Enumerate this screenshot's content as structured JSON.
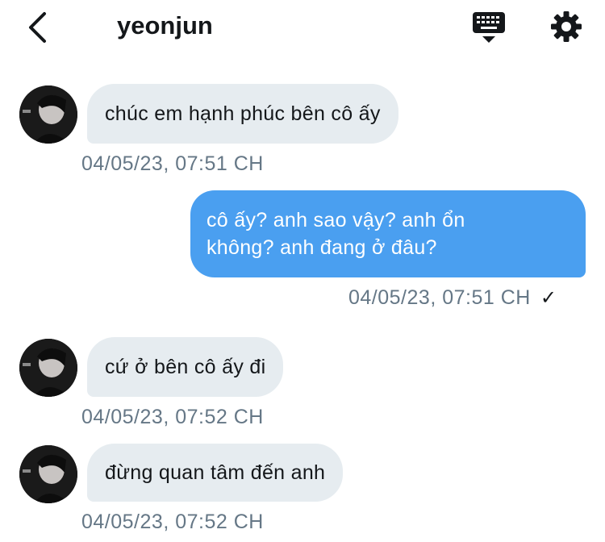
{
  "header": {
    "title": "yeonjun",
    "back_icon": "chevron-left-icon",
    "keyboard_icon": "keyboard-icon",
    "settings_icon": "gear-icon"
  },
  "messages": [
    {
      "direction": "incoming",
      "text": "chúc em hạnh phúc bên cô ấy",
      "timestamp": "04/05/23, 07:51 CH"
    },
    {
      "direction": "outgoing",
      "text": "cô ấy? anh sao vậy? anh ổn không? anh đang ở đâu?",
      "text_line1": "cô ấy? anh sao vậy? anh ổn",
      "text_line2": "không? anh đang ở đâu?",
      "timestamp": "04/05/23, 07:51 CH",
      "status": "✓"
    },
    {
      "direction": "incoming",
      "text": "cứ ở bên cô ấy đi",
      "timestamp": "04/05/23, 07:52 CH"
    },
    {
      "direction": "incoming",
      "text": "đừng quan tâm đến anh",
      "timestamp": "04/05/23, 07:52 CH"
    }
  ],
  "colors": {
    "outgoing_bubble": "#4a9ff0",
    "incoming_bubble": "#e6ecf0",
    "timestamp": "#657786"
  }
}
